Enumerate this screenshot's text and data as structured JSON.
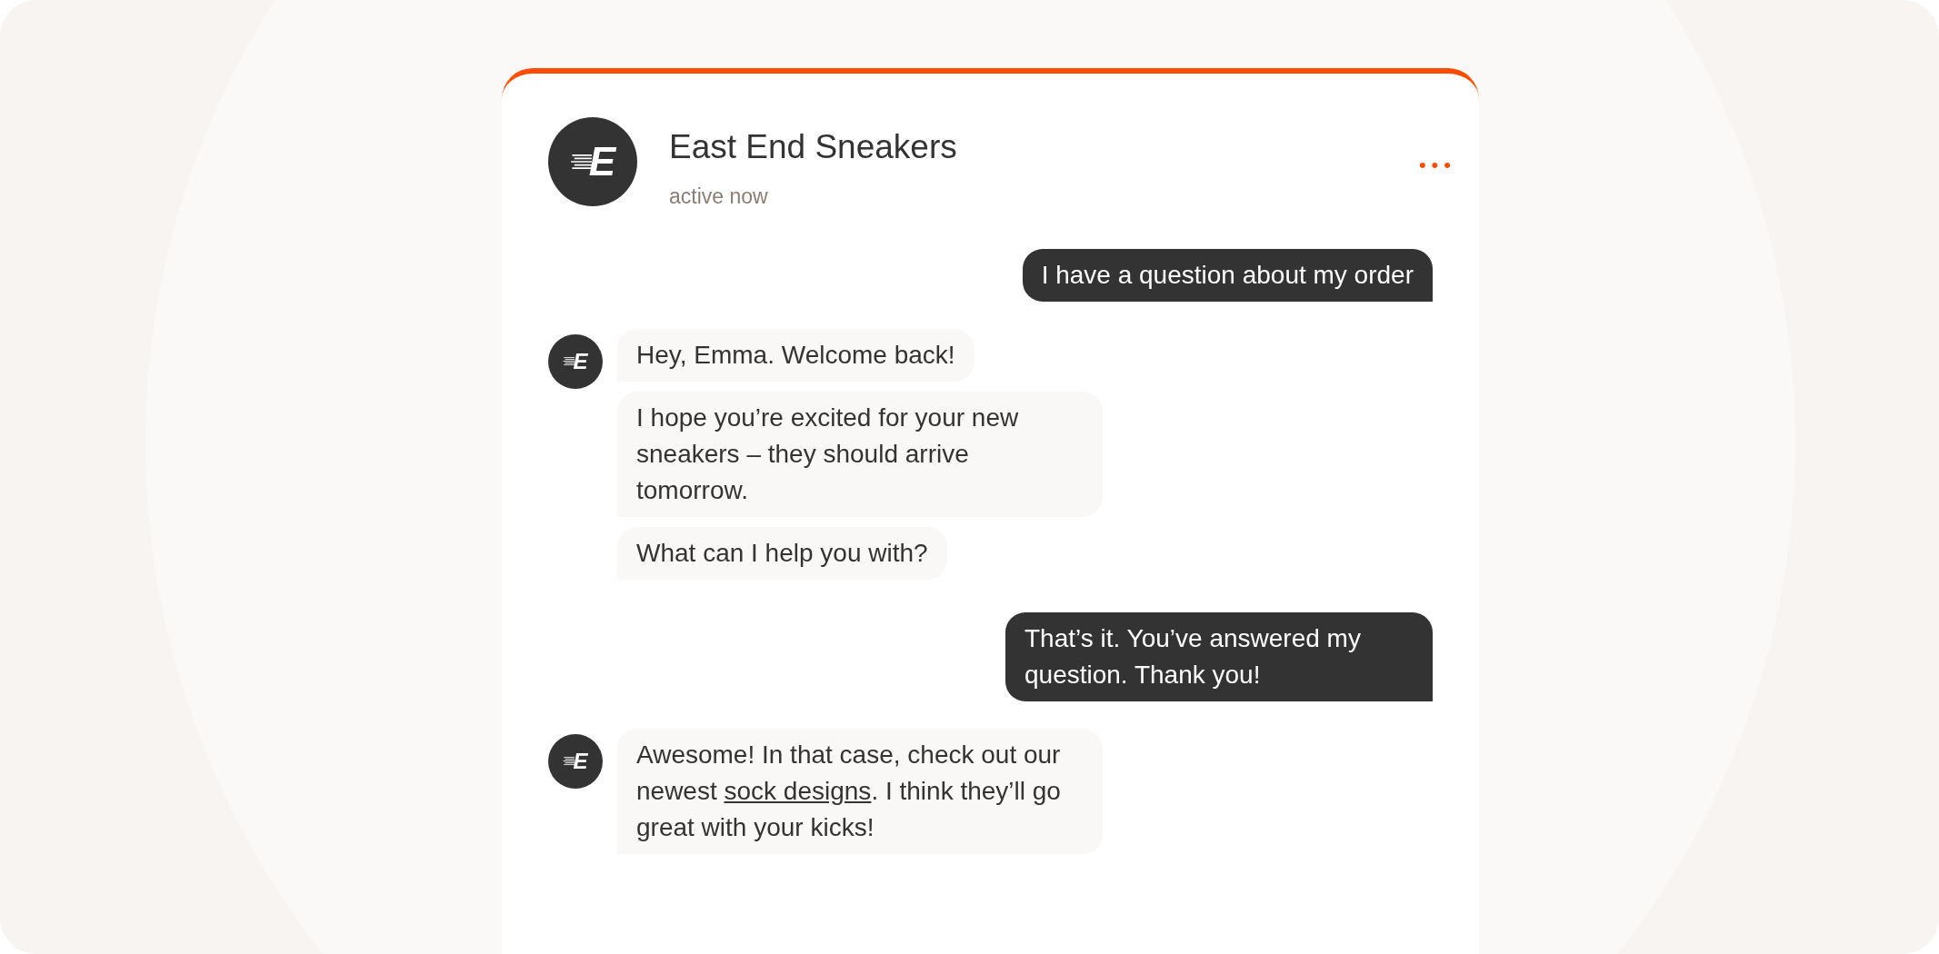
{
  "header": {
    "logo_letter": "E",
    "title": "East End Sneakers",
    "status": "active now",
    "menu": "•••"
  },
  "messages": [
    {
      "kind": "user",
      "bubbles": [
        {
          "text": "I have a question about my order"
        }
      ]
    },
    {
      "kind": "bot",
      "avatar_letter": "E",
      "bubbles": [
        {
          "text": "Hey, Emma. Welcome back!"
        },
        {
          "text": "I hope you’re excited for your new sneakers – they should arrive tomorrow."
        },
        {
          "text": "What can I help you with?"
        }
      ]
    },
    {
      "kind": "user",
      "bubbles": [
        {
          "text": "That’s it. You’ve answered my question. Thank you!"
        }
      ]
    },
    {
      "kind": "bot",
      "avatar_letter": "E",
      "bubbles": [
        {
          "text": "Awesome! In that case, check out our newest ",
          "link": "sock designs",
          "after": ". I think they’ll go great with your kicks!"
        }
      ]
    }
  ]
}
